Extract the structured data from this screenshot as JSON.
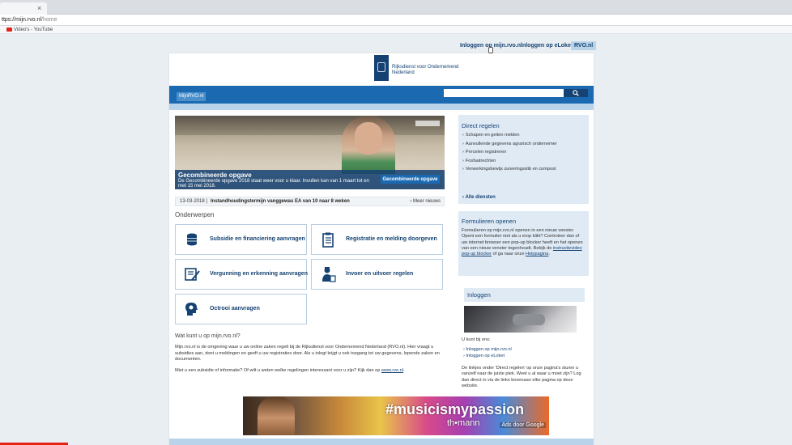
{
  "browser": {
    "tab_close": "×",
    "url_host": "ttps://mijn.rvo.nl",
    "url_path": "/home",
    "bookmark": "Video's - YouTube"
  },
  "toplinks": [
    {
      "label": "Inloggen op mijn.rvo.nl"
    },
    {
      "label": "Inloggen op eLoket"
    },
    {
      "label": "RVO.nl"
    }
  ],
  "header": {
    "logo_line1": "Rijksdienst voor Ondernemend",
    "logo_line2": "Nederland",
    "nav_tab": "MijnRVO.nl",
    "search_placeholder": ""
  },
  "hero": {
    "title": "Gecombineerde opgave",
    "text": "De Gecombineerde opgave 2018 staat weer voor u klaar. Invullen kan van 1 maart tot en met 15 mei 2018.",
    "button": "Gecombineerde opgave"
  },
  "news": {
    "date": "13-03-2018  |",
    "text": "Instandhoudingstermijn vanggewas EA van 10 naar 8 weken",
    "more": "› Meer nieuws"
  },
  "topics": {
    "title": "Onderwerpen",
    "items": [
      {
        "label": "Subsidie en financiering aanvragen"
      },
      {
        "label": "Registratie en melding doorgeven"
      },
      {
        "label": "Vergunning en erkenning aanvragen"
      },
      {
        "label": "Invoer en uitvoer regelen"
      },
      {
        "label": "Octrooi aanvragen"
      }
    ]
  },
  "about": {
    "title": "Wat kunt u op mijn.rvo.nl?",
    "para1": "Mijn.rvo.nl is de omgeving waar u uw online zaken regelt bij de Rijksdienst voor Ondernemend Nederland (RVO.nl). Hier vraagt u subsidies aan, doet u meldingen en geeft u uw registraties door. Als u inlogt krijgt u ook toegang tot uw gegevens, lopende zaken en documenten.",
    "para2_prefix": "Mist u een subsidie of informatie? Of wilt u weten welke regelingen interessant voor u zijn? Kijk dan op ",
    "para2_link": "www.rvo.nl",
    "para2_suffix": "."
  },
  "direct": {
    "title": "Direct regelen",
    "items": [
      "Schapen en geiten melden",
      "Aanvullende gegevens agrarisch ondernemer",
      "Percelen registreren",
      "Fosfaatrechten",
      "Verwerkingsbewijs zuiveringsslib en compost"
    ],
    "all": "› Alle diensten"
  },
  "forms": {
    "title": "Formulieren openen",
    "text_prefix": "Formulieren op mijn.rvo.nl openen in een nieuw venster. Opent een formulier niet als u erop klikt? Controleer dan of uw internet browser een pop-up blocker heeft en het openen van een nieuw venster tegenhoudt. Bekijk de ",
    "link1": "instructievideo pop-up blocker",
    "text_mid": " of ga naar onze ",
    "link2": "Helppagina",
    "text_suffix": "."
  },
  "login": {
    "title": "Inloggen",
    "intro": "U kunt bij ons:",
    "links": [
      "› Inloggen op mijn.rvo.nl",
      "› Inloggen op eLoket"
    ],
    "text": "De linkjes onder 'Direct regelen' op onze pagina's sturen u vanzelf naar de juiste plek. Weet u al waar u moet zijn? Log dan direct in via de links bovenaan elke pagina op deze website."
  },
  "ad": {
    "tag": "#musicismypassion",
    "brand": "th•mann",
    "google": "Ads door Google"
  },
  "colors": {
    "brand_blue": "#154273",
    "nav_blue": "#1b6ab1",
    "light_blue": "#dfeaf5",
    "youtube_red": "#e62117"
  }
}
